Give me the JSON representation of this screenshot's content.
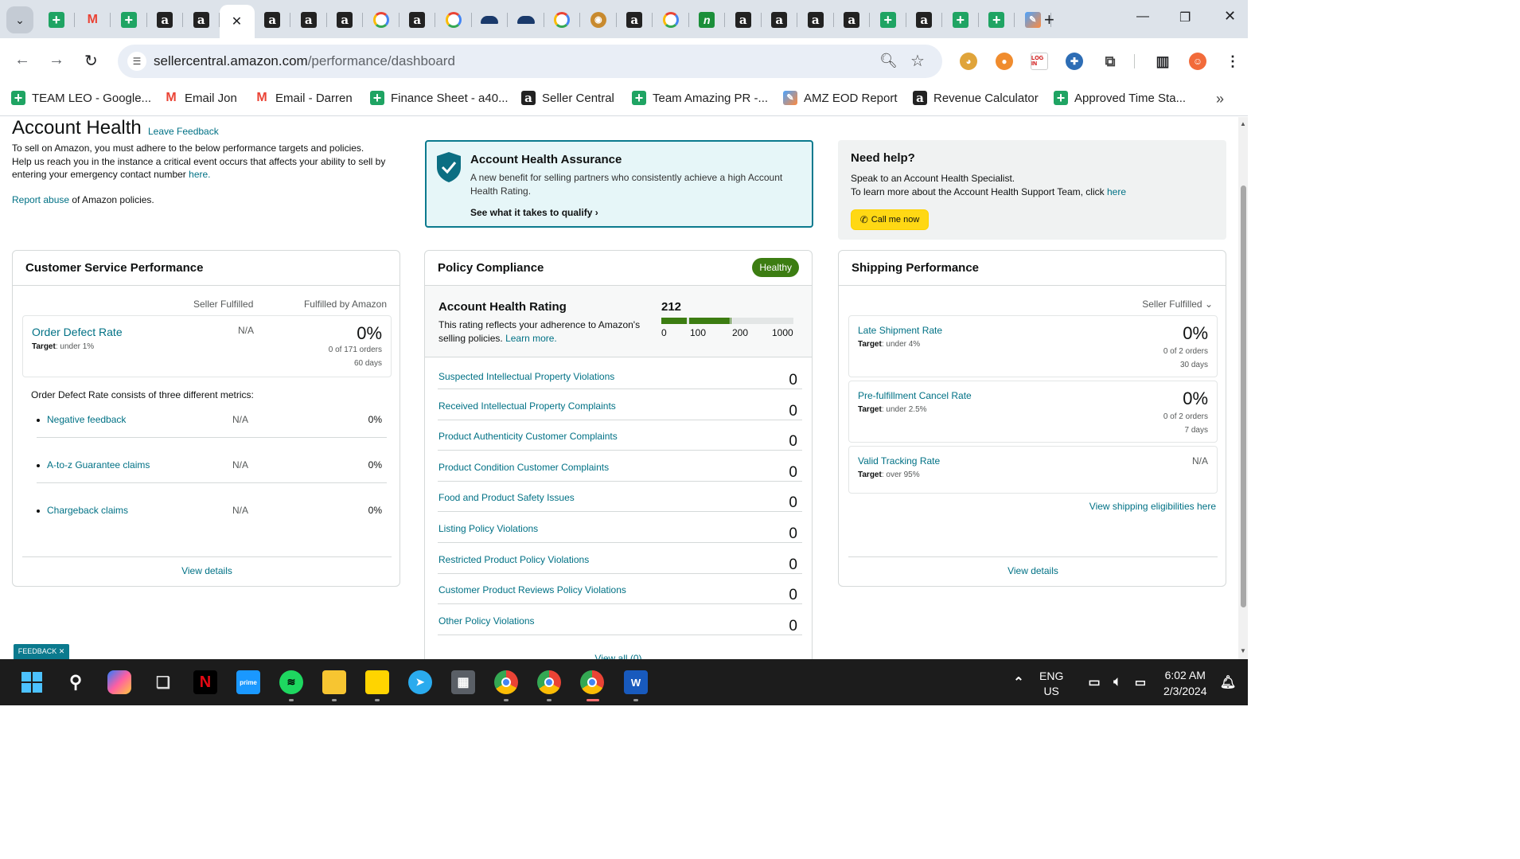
{
  "browser": {
    "tabs": [
      {
        "icon": "google-sheets-icon",
        "glyph": "+",
        "kind": "sheet"
      },
      {
        "icon": "gmail-icon",
        "glyph": "M",
        "kind": "mail"
      },
      {
        "icon": "google-sheets-icon",
        "glyph": "+",
        "kind": "sheet"
      },
      {
        "icon": "amazon-icon",
        "glyph": "a",
        "kind": "amz"
      },
      {
        "icon": "amazon-icon",
        "glyph": "a",
        "kind": "amz"
      },
      {
        "icon": "close-icon",
        "glyph": "✕",
        "kind": "active"
      },
      {
        "icon": "amazon-icon",
        "glyph": "a",
        "kind": "amz"
      },
      {
        "icon": "amazon-icon",
        "glyph": "a",
        "kind": "amz"
      },
      {
        "icon": "amazon-icon",
        "glyph": "a",
        "kind": "amz"
      },
      {
        "icon": "google-icon",
        "glyph": "G",
        "kind": "g"
      },
      {
        "icon": "amazon-icon",
        "glyph": "a",
        "kind": "amz"
      },
      {
        "icon": "google-icon",
        "glyph": "G",
        "kind": "g"
      },
      {
        "icon": "cloud-icon",
        "glyph": "",
        "kind": "cloud"
      },
      {
        "icon": "cloud-icon",
        "glyph": "",
        "kind": "cloud"
      },
      {
        "icon": "google-icon",
        "glyph": "G",
        "kind": "g"
      },
      {
        "icon": "ninja-icon",
        "glyph": "◉",
        "kind": "ninja"
      },
      {
        "icon": "amazon-icon",
        "glyph": "a",
        "kind": "amz"
      },
      {
        "icon": "google-icon",
        "glyph": "G",
        "kind": "g"
      },
      {
        "icon": "n-logo-icon",
        "glyph": "n",
        "kind": "n"
      },
      {
        "icon": "amazon-icon",
        "glyph": "a",
        "kind": "amz"
      },
      {
        "icon": "amazon-icon",
        "glyph": "a",
        "kind": "amz"
      },
      {
        "icon": "amazon-icon",
        "glyph": "a",
        "kind": "amz"
      },
      {
        "icon": "amazon-icon",
        "glyph": "a",
        "kind": "amz"
      },
      {
        "icon": "google-sheets-icon",
        "glyph": "+",
        "kind": "sheet"
      },
      {
        "icon": "amazon-icon",
        "glyph": "a",
        "kind": "amz"
      },
      {
        "icon": "google-sheets-icon",
        "glyph": "+",
        "kind": "sheet"
      },
      {
        "icon": "google-sheets-icon",
        "glyph": "+",
        "kind": "sheet"
      },
      {
        "icon": "pen-icon",
        "glyph": "✎",
        "kind": "pen"
      }
    ],
    "url_host": "sellercentral.amazon.com",
    "url_path": "/performance/dashboard",
    "bookmarks": [
      {
        "label": "TEAM LEO - Google...",
        "icon": "google-sheets-icon",
        "glyph": "+",
        "kind": "sheet"
      },
      {
        "label": "Email Jon",
        "icon": "gmail-icon",
        "glyph": "M",
        "kind": "mail"
      },
      {
        "label": "Email - Darren",
        "icon": "gmail-icon",
        "glyph": "M",
        "kind": "mail"
      },
      {
        "label": "Finance Sheet - a40...",
        "icon": "google-sheets-icon",
        "glyph": "+",
        "kind": "sheet"
      },
      {
        "label": "Seller Central",
        "icon": "amazon-icon",
        "glyph": "a",
        "kind": "amz"
      },
      {
        "label": "Team Amazing PR -...",
        "icon": "google-sheets-icon",
        "glyph": "+",
        "kind": "sheet"
      },
      {
        "label": "AMZ EOD Report",
        "icon": "pen-icon",
        "glyph": "✎",
        "kind": "pen"
      },
      {
        "label": "Revenue Calculator",
        "icon": "amazon-icon",
        "glyph": "a",
        "kind": "amz"
      },
      {
        "label": "Approved Time Sta...",
        "icon": "google-sheets-icon",
        "glyph": "+",
        "kind": "sheet"
      }
    ]
  },
  "page": {
    "title": "Account Health",
    "leave_feedback": "Leave Feedback",
    "intro_1": "To sell on Amazon, you must adhere to the below performance targets and policies.",
    "intro_2": "Help us reach you in the instance a critical event occurs that affects your ability to sell by entering your emergency contact number",
    "intro_here": "here.",
    "report_abuse": "Report abuse",
    "report_rest": " of Amazon policies.",
    "assurance": {
      "title": "Account Health Assurance",
      "desc": "A new benefit for selling partners who consistently achieve a high Account Health Rating.",
      "link": "See what it takes to qualify"
    },
    "help": {
      "title": "Need help?",
      "line1": "Speak to an Account Health Specialist.",
      "line2": "To learn more about the Account Health Support Team, click",
      "here": "here",
      "call": "Call me now"
    },
    "csp": {
      "title": "Customer Service Performance",
      "col_seller": "Seller Fulfilled",
      "col_fba": "Fulfilled by Amazon",
      "odr": {
        "name": "Order Defect Rate",
        "target_label": "Target",
        "target_value": ": under 1%",
        "seller": "N/A",
        "pct": "0%",
        "orders": "0 of 171 orders",
        "days": "60 days"
      },
      "consists": "Order Defect Rate consists of three different metrics:",
      "metrics": [
        {
          "name": "Negative feedback",
          "seller": "N/A",
          "pct": "0%"
        },
        {
          "name": "A-to-z Guarantee claims",
          "seller": "N/A",
          "pct": "0%"
        },
        {
          "name": "Chargeback claims",
          "seller": "N/A",
          "pct": "0%"
        }
      ],
      "view_details": "View details"
    },
    "policy": {
      "title": "Policy Compliance",
      "badge": "Healthy",
      "ahr_title": "Account Health Rating",
      "ahr_desc": "This rating reflects your adherence to Amazon's selling policies.",
      "ahr_learn": "Learn more.",
      "score": "212",
      "score_value": 212,
      "ticks": [
        "0",
        "100",
        "200",
        "1000"
      ],
      "violations": [
        {
          "name": "Suspected Intellectual Property Violations",
          "count": "0"
        },
        {
          "name": "Received Intellectual Property Complaints",
          "count": "0"
        },
        {
          "name": "Product Authenticity Customer Complaints",
          "count": "0"
        },
        {
          "name": "Product Condition Customer Complaints",
          "count": "0"
        },
        {
          "name": "Food and Product Safety Issues",
          "count": "0"
        },
        {
          "name": "Listing Policy Violations",
          "count": "0"
        },
        {
          "name": "Restricted Product Policy Violations",
          "count": "0"
        },
        {
          "name": "Customer Product Reviews Policy Violations",
          "count": "0"
        },
        {
          "name": "Other Policy Violations",
          "count": "0"
        }
      ],
      "view_all": "View all (0)"
    },
    "shipping": {
      "title": "Shipping Performance",
      "selector": "Seller Fulfilled",
      "metrics": [
        {
          "name": "Late Shipment Rate",
          "target_label": "Target",
          "target_value": ": under 4%",
          "pct": "0%",
          "orders": "0 of 2 orders",
          "days": "30 days"
        },
        {
          "name": "Pre-fulfillment Cancel Rate",
          "target_label": "Target",
          "target_value": ": under 2.5%",
          "pct": "0%",
          "orders": "0 of 2 orders",
          "days": "7 days"
        },
        {
          "name": "Valid Tracking Rate",
          "target_label": "Target",
          "target_value": ": over 95%",
          "na": "N/A"
        }
      ],
      "eligibilities": "View shipping eligibilities here",
      "view_details": "View details"
    },
    "feedback_tab": "FEEDBACK ✕"
  },
  "taskbar": {
    "lang_1": "ENG",
    "lang_2": "US",
    "time": "6:02 AM",
    "date": "2/3/2024"
  },
  "colors": {
    "accent_teal": "#007185",
    "healthy_green": "#3c7d12",
    "call_button": "#ffd814",
    "assurance_border": "#0b7a8e"
  }
}
